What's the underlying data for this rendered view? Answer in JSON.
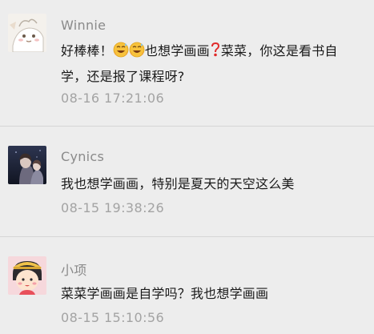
{
  "comments": [
    {
      "username": "Winnie",
      "text_before": "好棒棒！",
      "emoji_1": "grinning-sweat-emoji",
      "emoji_2": "grinning-sweat-emoji",
      "text_middle": "也想学画画",
      "emoji_3": "red-question-mark-emoji",
      "text_after": "菜菜，你这是看书自学，还是报了课程呀?",
      "time": "08-16 17:21:06"
    },
    {
      "username": "Cynics",
      "text": "我也想学画画，特别是夏天的天空这么美",
      "time": "08-15 19:38:26"
    },
    {
      "username": "小项",
      "text": "菜菜学画画是自学吗？我也想学画画",
      "time": "08-15 15:10:56"
    }
  ],
  "colors": {
    "background": "#ededed",
    "username": "#8a8a8a",
    "text": "#1a1a1a",
    "time": "#a3a3a3",
    "divider": "#d6d6d6"
  }
}
